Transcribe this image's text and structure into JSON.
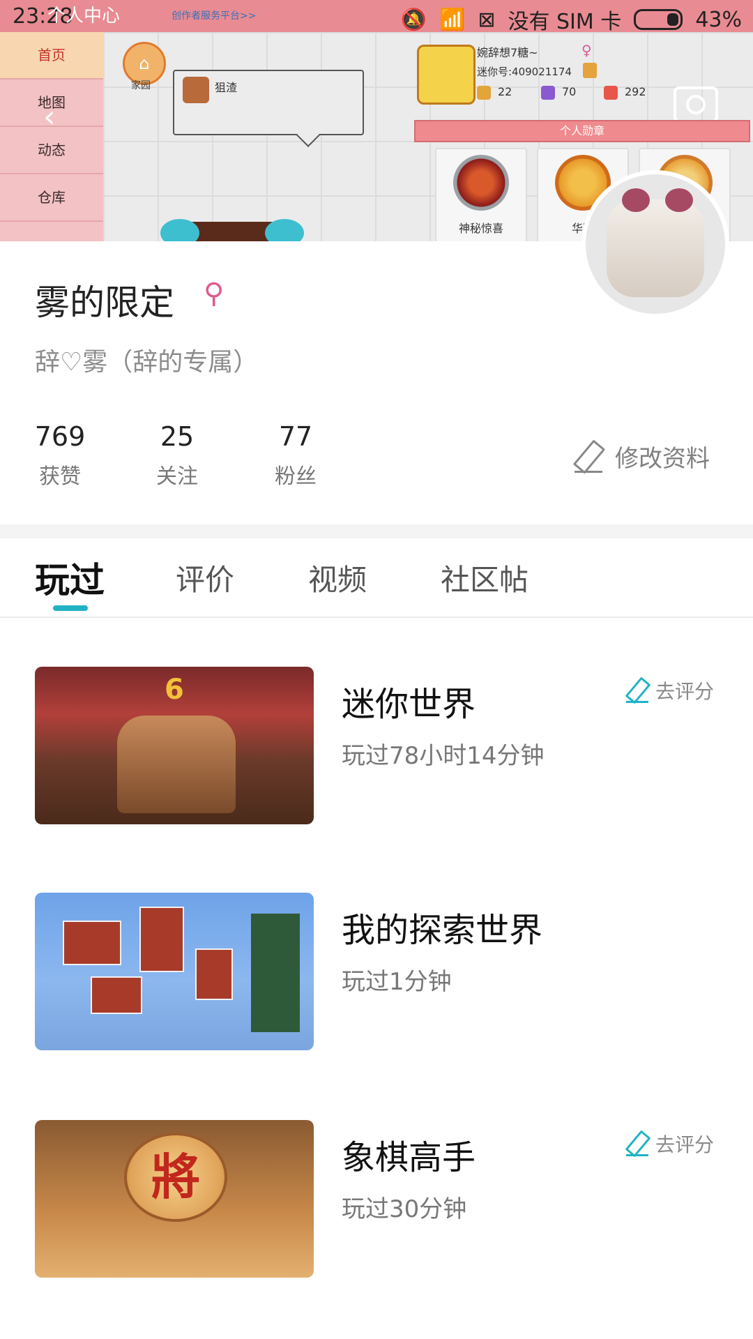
{
  "status_bar": {
    "time": "23:28",
    "page_title": "个人中心",
    "link_text": "创作者服务平台>>",
    "sim_text": "没有 SIM 卡",
    "battery": "43%"
  },
  "banner": {
    "side_menu": [
      "首页",
      "地图",
      "动态",
      "仓库"
    ],
    "home_label": "家园",
    "bubble_text": "狙渣",
    "game_user_name": "婉辞想7糖~",
    "game_user_id": "迷你号:409021174",
    "stats": [
      "22",
      "70",
      "292"
    ],
    "medal_bar_label": "个人勋章",
    "medals": [
      "神秘惊喜",
      "华丽",
      ""
    ]
  },
  "profile": {
    "nickname": "雾的限定",
    "signature": "辞♡雾（辞的专属）",
    "stats": [
      {
        "value": "769",
        "label": "获赞"
      },
      {
        "value": "25",
        "label": "关注"
      },
      {
        "value": "77",
        "label": "粉丝"
      }
    ],
    "edit_label": "修改资料"
  },
  "tabs": [
    "玩过",
    "评价",
    "视频",
    "社区帖"
  ],
  "games": [
    {
      "title": "迷你世界",
      "played": "玩过78小时14分钟",
      "rate_label": "去评分"
    },
    {
      "title": "我的探索世界",
      "played": "玩过1分钟",
      "rate_label": ""
    },
    {
      "title": "象棋高手",
      "played": "玩过30分钟",
      "rate_label": "去评分"
    }
  ],
  "thumb_text": {
    "cake_number": "6",
    "chess_piece": "將"
  }
}
